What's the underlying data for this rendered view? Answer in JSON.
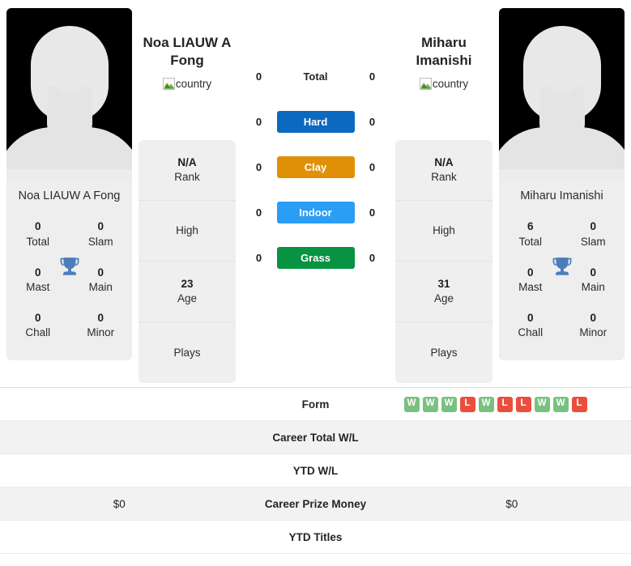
{
  "players": {
    "left": {
      "name": "Noa LIAUW A Fong",
      "name_heading": "Noa LIAUW A Fong",
      "country_alt": "country",
      "rank": "N/A",
      "rank_label": "Rank",
      "high": "",
      "high_label": "High",
      "age": "23",
      "age_label": "Age",
      "plays": "",
      "plays_label": "Plays",
      "titles": [
        {
          "value": "0",
          "label": "Total"
        },
        {
          "value": "0",
          "label": "Slam"
        },
        {
          "value": "0",
          "label": "Mast"
        },
        {
          "value": "0",
          "label": "Main"
        },
        {
          "value": "0",
          "label": "Chall"
        },
        {
          "value": "0",
          "label": "Minor"
        }
      ]
    },
    "right": {
      "name": "Miharu Imanishi",
      "name_heading": "Miharu Imanishi",
      "country_alt": "country",
      "rank": "N/A",
      "rank_label": "Rank",
      "high": "",
      "high_label": "High",
      "age": "31",
      "age_label": "Age",
      "plays": "",
      "plays_label": "Plays",
      "titles": [
        {
          "value": "6",
          "label": "Total"
        },
        {
          "value": "0",
          "label": "Slam"
        },
        {
          "value": "0",
          "label": "Mast"
        },
        {
          "value": "0",
          "label": "Main"
        },
        {
          "value": "0",
          "label": "Chall"
        },
        {
          "value": "0",
          "label": "Minor"
        }
      ]
    }
  },
  "surfaces": [
    {
      "label": "Total",
      "left": "0",
      "right": "0",
      "color": "transparent"
    },
    {
      "label": "Hard",
      "left": "0",
      "right": "0",
      "color": "#0b69c0"
    },
    {
      "label": "Clay",
      "left": "0",
      "right": "0",
      "color": "#e09108"
    },
    {
      "label": "Indoor",
      "left": "0",
      "right": "0",
      "color": "#2a9df4"
    },
    {
      "label": "Grass",
      "left": "0",
      "right": "0",
      "color": "#079341"
    }
  ],
  "table": [
    {
      "label": "Form",
      "left": "",
      "right": "",
      "form": [
        "W",
        "W",
        "W",
        "L",
        "W",
        "L",
        "L",
        "W",
        "W",
        "L"
      ]
    },
    {
      "label": "Career Total W/L",
      "left": "",
      "right": ""
    },
    {
      "label": "YTD W/L",
      "left": "",
      "right": ""
    },
    {
      "label": "Career Prize Money",
      "left": "$0",
      "right": "$0"
    },
    {
      "label": "YTD Titles",
      "left": "",
      "right": ""
    }
  ],
  "colors": {
    "win": "#7ac17f",
    "loss": "#ea4f3d",
    "trophy": "#4a7ebb",
    "card_bg": "#eeeeee"
  }
}
